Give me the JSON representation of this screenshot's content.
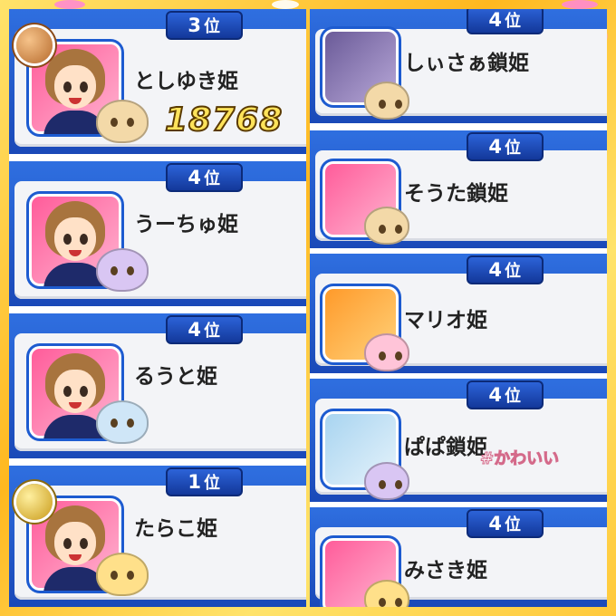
{
  "colors": {
    "frame": "#ffd21a",
    "card_blue": "#1f5ad0",
    "rank_tab": "#1b48b5",
    "panel": "#f3f4f7",
    "score_fill": "#ffe35a"
  },
  "left_column": [
    {
      "rank_num": "3",
      "rank_suffix": "位",
      "name": "としゆき姫",
      "score": "18768",
      "medal": "bronze",
      "tsum_color": "#f3d9a8"
    },
    {
      "rank_num": "4",
      "rank_suffix": "位",
      "name": "うーちゅ姫",
      "tsum_color": "#d9c6f3"
    },
    {
      "rank_num": "4",
      "rank_suffix": "位",
      "name": "るうと姫",
      "tsum_color": "#cfe6f7"
    },
    {
      "rank_num": "1",
      "rank_suffix": "位",
      "name": "たらこ姫",
      "medal": "gold",
      "tsum_color": "#ffe08a"
    }
  ],
  "right_column": [
    {
      "rank_num": "4",
      "rank_suffix": "位",
      "name": "しぃさぁ鎖姫",
      "tsum_color": "#f3d9a8",
      "avatar_bg": "#7a6aa8"
    },
    {
      "rank_num": "4",
      "rank_suffix": "位",
      "name": "そうた鎖姫",
      "tsum_color": "#f3d9a8",
      "avatar_bg": "#ff6aa0"
    },
    {
      "rank_num": "4",
      "rank_suffix": "位",
      "name": "マリオ姫",
      "tsum_color": "#ffc4d8",
      "avatar_bg": "#ffb23a"
    },
    {
      "rank_num": "4",
      "rank_suffix": "位",
      "name": "ぱぱ鎖姫",
      "tsum_color": "#d9c6f3",
      "avatar_bg": "#c8e4f7"
    },
    {
      "rank_num": "4",
      "rank_suffix": "位",
      "name": "みさき姫",
      "tsum_color": "#ffe08a",
      "avatar_bg": "#ff6aa0"
    }
  ],
  "hashtag": "#かわいい"
}
